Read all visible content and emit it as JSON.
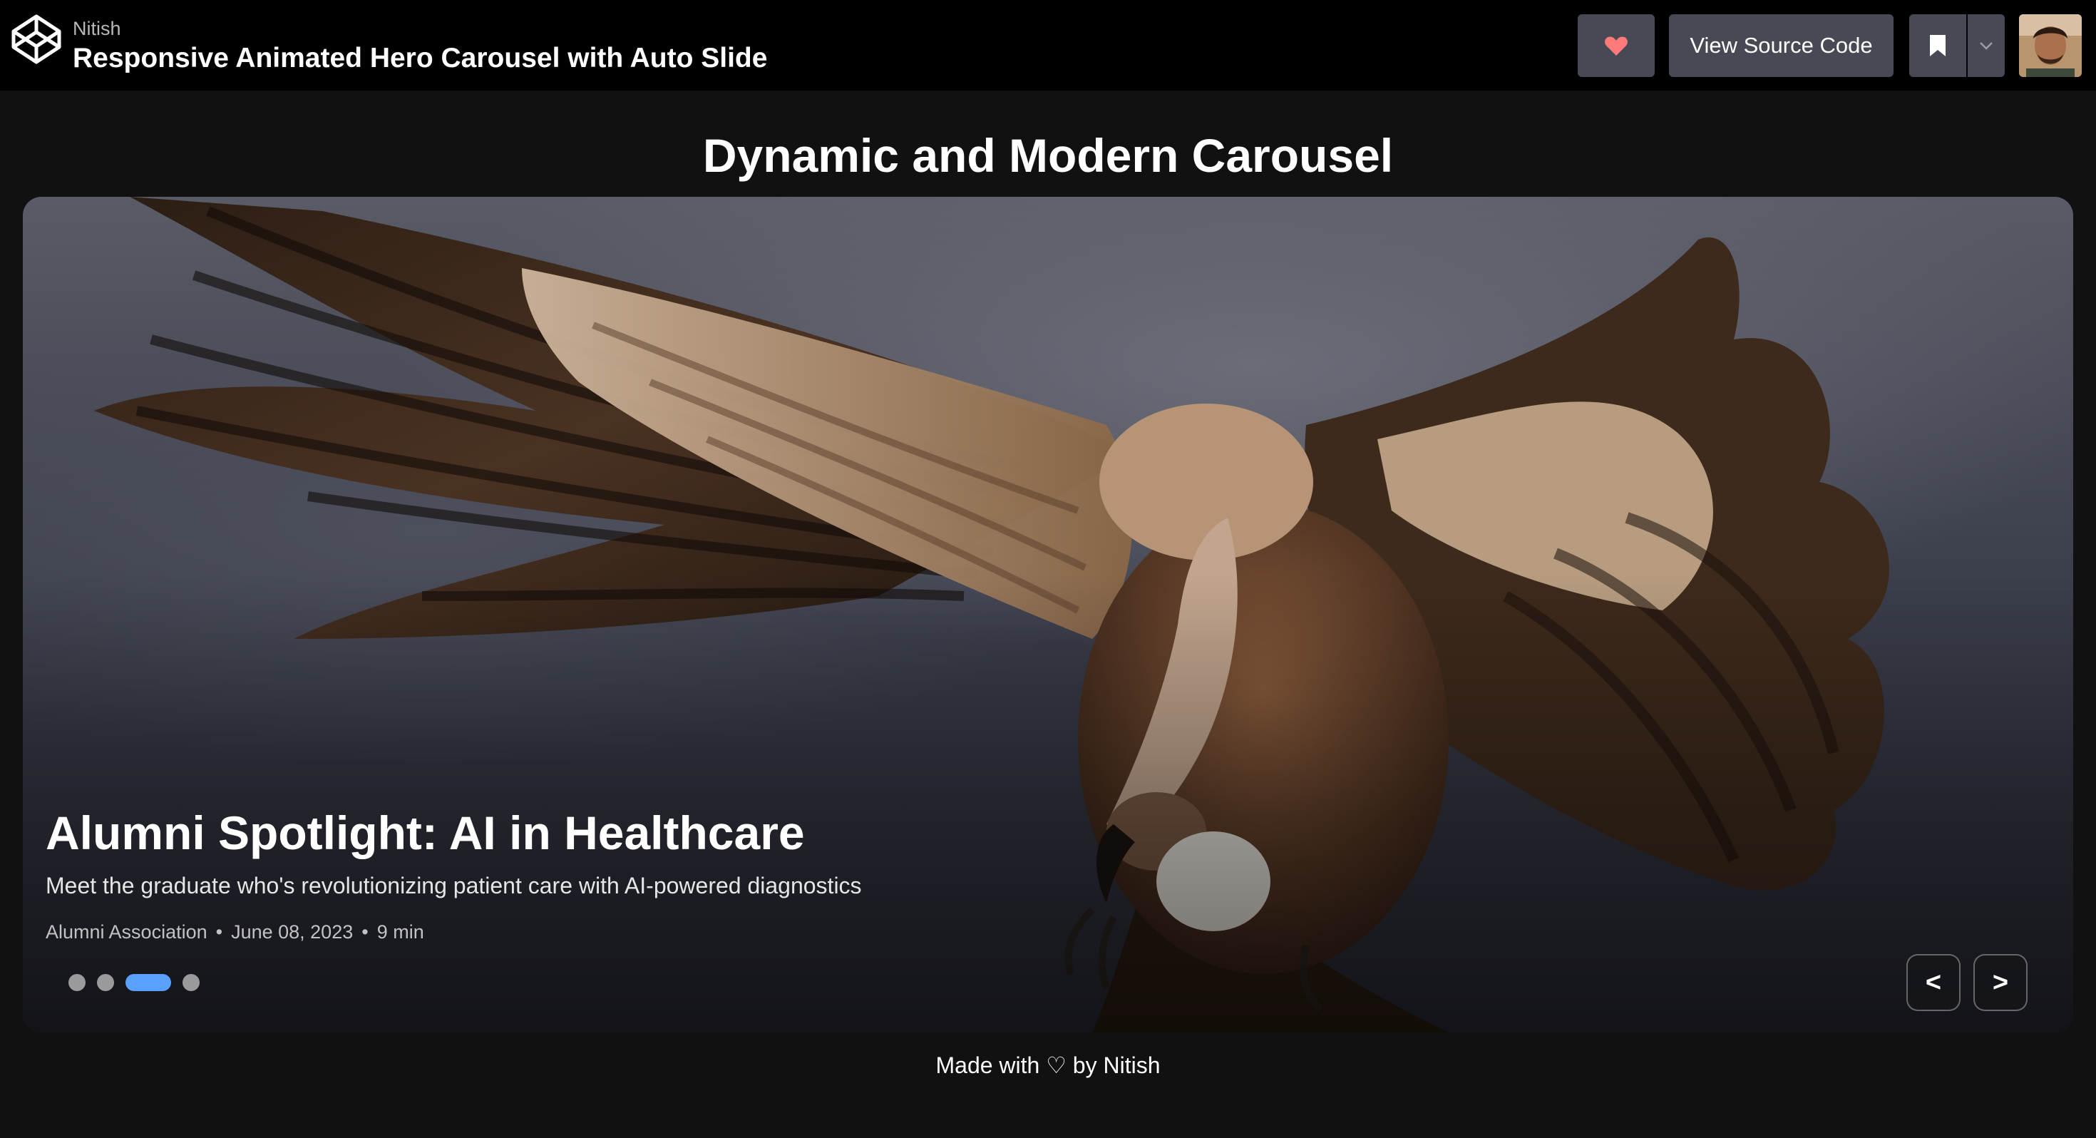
{
  "header": {
    "author": "Nitish",
    "title": "Responsive Animated Hero Carousel with Auto Slide",
    "view_source_label": "View Source Code"
  },
  "page": {
    "heading": "Dynamic and Modern Carousel"
  },
  "slide": {
    "title": "Alumni Spotlight: AI in Healthcare",
    "subtitle": "Meet the graduate who's revolutionizing patient care with AI-powered diagnostics",
    "source": "Alumni Association",
    "date": "June 08, 2023",
    "read_time": "9 min",
    "separator": "•"
  },
  "carousel": {
    "slide_count": 4,
    "active_index": 3,
    "prev_label": "<",
    "next_label": ">",
    "active_dot_color": "#5aa0ff"
  },
  "footer": {
    "text": "Made with ♡ by Nitish"
  },
  "colors": {
    "heart": "#ff7a7a",
    "topbar": "#000000",
    "background": "#111111",
    "button": "#474a54"
  }
}
